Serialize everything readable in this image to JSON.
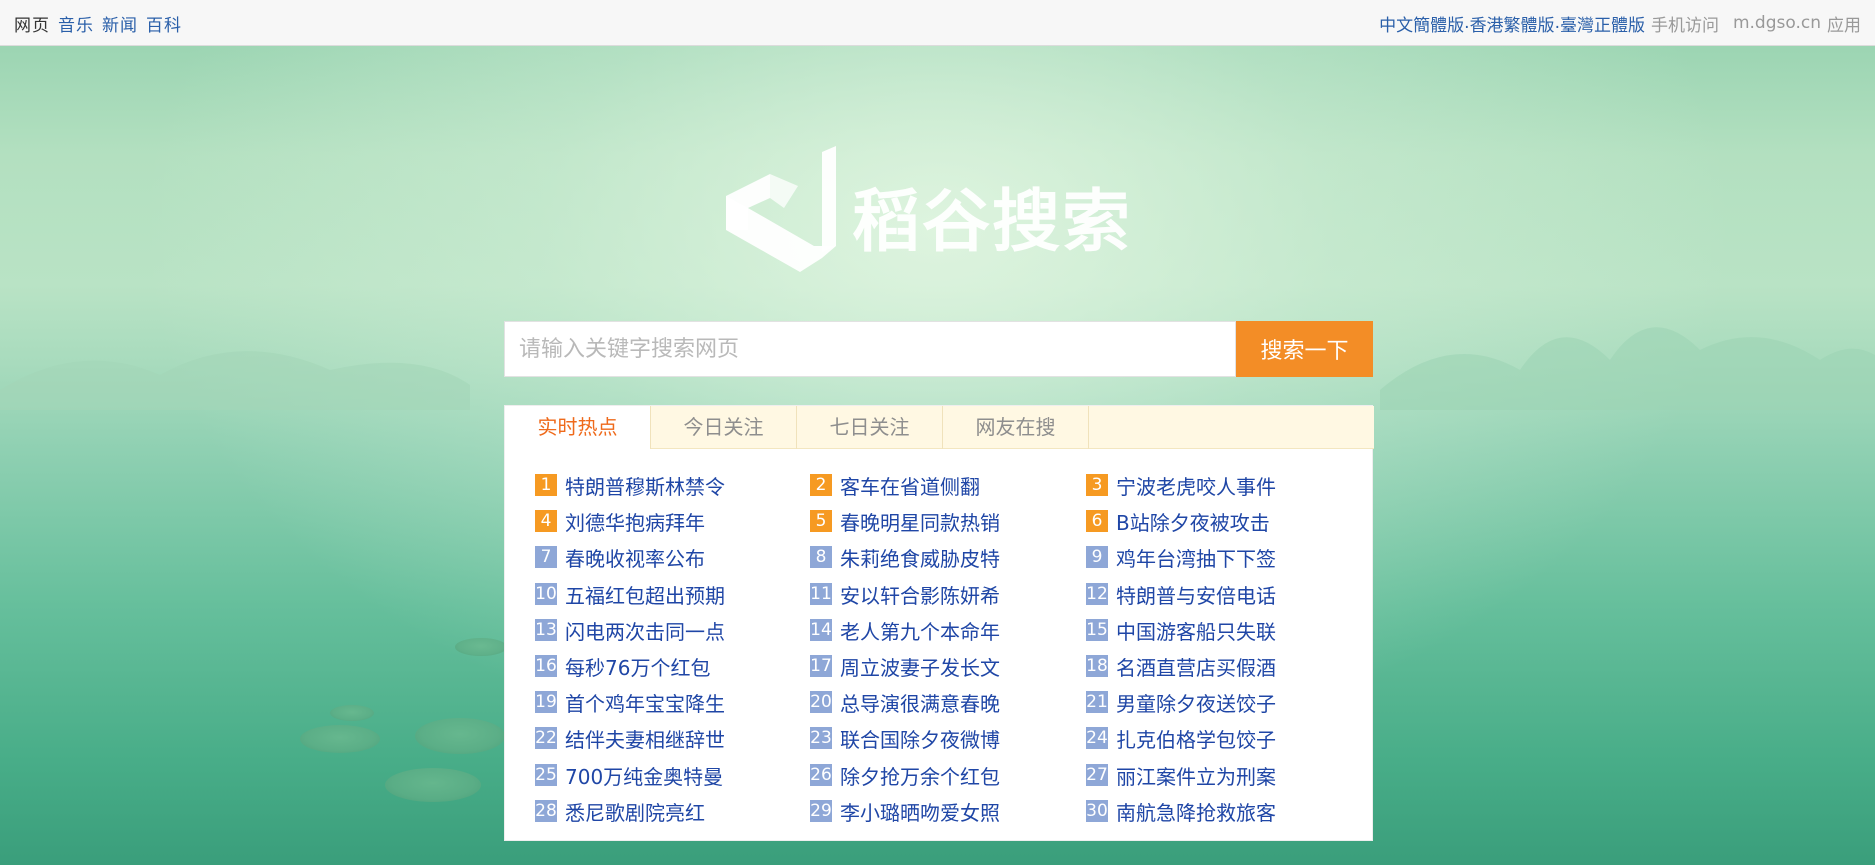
{
  "topbar": {
    "nav": [
      "网页",
      "音乐",
      "新闻",
      "百科"
    ],
    "lang_links": [
      "中文簡體版",
      "香港繁體版",
      "臺灣正體版"
    ],
    "lang_separator": ".",
    "mobile_label": "手机访问",
    "mobile_url": "m.dgso.cn",
    "app_label": "应用"
  },
  "logo": {
    "text": "稻谷搜索"
  },
  "search": {
    "placeholder": "请输入关键字搜索网页",
    "value": "",
    "button_label": "搜索一下"
  },
  "hot_panel": {
    "tabs": [
      "实时热点",
      "今日关注",
      "七日关注",
      "网友在搜"
    ],
    "active_tab": 0,
    "items": [
      {
        "rank": "1",
        "title": "特朗普穆斯林禁令"
      },
      {
        "rank": "2",
        "title": "客车在省道侧翻"
      },
      {
        "rank": "3",
        "title": "宁波老虎咬人事件"
      },
      {
        "rank": "4",
        "title": "刘德华抱病拜年"
      },
      {
        "rank": "5",
        "title": "春晚明星同款热销"
      },
      {
        "rank": "6",
        "title": "B站除夕夜被攻击"
      },
      {
        "rank": "7",
        "title": "春晚收视率公布"
      },
      {
        "rank": "8",
        "title": "朱莉绝食威胁皮特"
      },
      {
        "rank": "9",
        "title": "鸡年台湾抽下下签"
      },
      {
        "rank": "10",
        "title": "五福红包超出预期"
      },
      {
        "rank": "11",
        "title": "安以轩合影陈妍希"
      },
      {
        "rank": "12",
        "title": "特朗普与安倍电话"
      },
      {
        "rank": "13",
        "title": "闪电两次击同一点"
      },
      {
        "rank": "14",
        "title": "老人第九个本命年"
      },
      {
        "rank": "15",
        "title": "中国游客船只失联"
      },
      {
        "rank": "16",
        "title": "每秒76万个红包"
      },
      {
        "rank": "17",
        "title": "周立波妻子发长文"
      },
      {
        "rank": "18",
        "title": "名酒直营店买假酒"
      },
      {
        "rank": "19",
        "title": "首个鸡年宝宝降生"
      },
      {
        "rank": "20",
        "title": "总导演很满意春晚"
      },
      {
        "rank": "21",
        "title": "男童除夕夜送饺子"
      },
      {
        "rank": "22",
        "title": "结伴夫妻相继辞世"
      },
      {
        "rank": "23",
        "title": "联合国除夕夜微博"
      },
      {
        "rank": "24",
        "title": "扎克伯格学包饺子"
      },
      {
        "rank": "25",
        "title": "700万纯金奥特曼"
      },
      {
        "rank": "26",
        "title": "除夕抢万余个红包"
      },
      {
        "rank": "27",
        "title": "丽江案件立为刑案"
      },
      {
        "rank": "28",
        "title": "悉尼歌剧院亮红"
      },
      {
        "rank": "29",
        "title": "李小璐晒吻爱女照"
      },
      {
        "rank": "30",
        "title": "南航急降抢救旅客"
      }
    ]
  },
  "colors": {
    "accent": "#f38d26",
    "link": "#1f46a6",
    "hot_rank": "#f69a22",
    "rank": "#8ea7d7",
    "active_tab": "#ef6a1b"
  }
}
